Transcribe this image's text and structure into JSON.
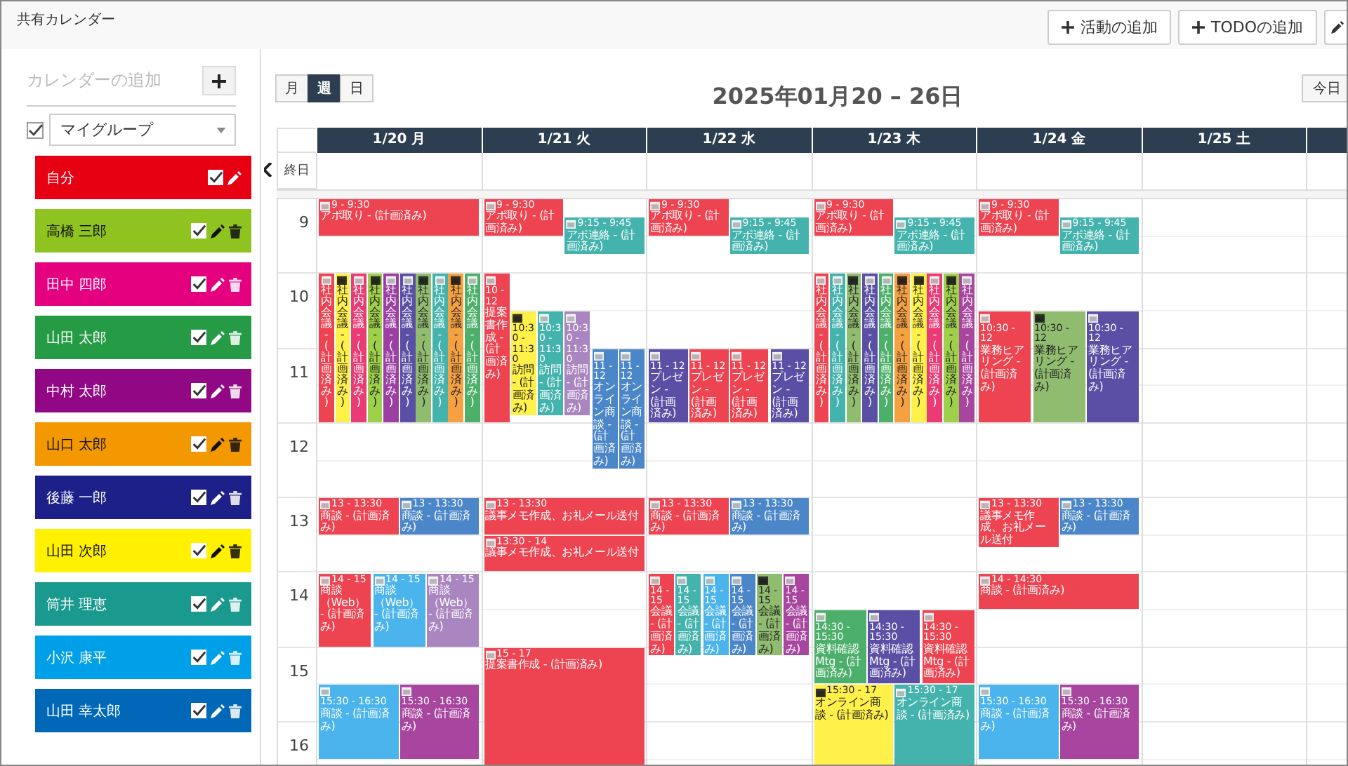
{
  "header": {
    "title": "共有カレンダー",
    "buttons": [
      "活動の追加",
      "TODOの追加"
    ]
  },
  "sidebar": {
    "add_label": "カレンダーの追加",
    "group": {
      "name": "マイグループ",
      "checked": true
    },
    "calendars": [
      {
        "name": "自分",
        "color": "#e60012",
        "checked": true,
        "deletable": false
      },
      {
        "name": "高橋 三郎",
        "color": "#8fc31f",
        "checked": true,
        "deletable": true
      },
      {
        "name": "田中 四郎",
        "color": "#e4007f",
        "checked": true,
        "deletable": true
      },
      {
        "name": "山田 太郎",
        "color": "#259b45",
        "checked": true,
        "deletable": true
      },
      {
        "name": "中村 太郎",
        "color": "#920783",
        "checked": true,
        "deletable": true
      },
      {
        "name": "山口 太郎",
        "color": "#f39800",
        "checked": true,
        "deletable": true
      },
      {
        "name": "後藤 一郎",
        "color": "#1d2088",
        "checked": true,
        "deletable": true
      },
      {
        "name": "山田 次郎",
        "color": "#fff100",
        "checked": true,
        "deletable": true
      },
      {
        "name": "筒井 理恵",
        "color": "#1a9a8e",
        "checked": true,
        "deletable": true
      },
      {
        "name": "小沢 康平",
        "color": "#00a0e9",
        "checked": true,
        "deletable": true
      },
      {
        "name": "山田 幸太郎",
        "color": "#0068b7",
        "checked": true,
        "deletable": true
      }
    ]
  },
  "views": [
    {
      "label": "月",
      "selected": false
    },
    {
      "label": "週",
      "selected": true
    },
    {
      "label": "日",
      "selected": false
    }
  ],
  "range_title": "2025年01月20 – 26日",
  "today_button": "今日",
  "all_day_label": "終日",
  "hours": [
    "9",
    "10",
    "11",
    "12",
    "13",
    "14",
    "15",
    "16"
  ],
  "days": [
    {
      "label": "1/20 月",
      "events": [
        {
          "time": "9 - 9:30",
          "title": "アポ取り - (計画済み)",
          "color": "#ee4451"
        },
        {
          "title": "社内会議 - (計画済み)",
          "color": "#ee4451"
        },
        {
          "title": "社内会議 - (計画済み)",
          "color": "#fff04a"
        },
        {
          "title": "社内会議 - (計画済み)",
          "color": "#ea3b74"
        },
        {
          "title": "社内会議 - (計画済み)",
          "color": "#9fd04a"
        },
        {
          "title": "社内会議 - (計画済み)",
          "color": "#9b3fa3"
        },
        {
          "title": "社内会議 - (計画済み)",
          "color": "#5b4ea5"
        },
        {
          "title": "社内会議 - (計画済み)",
          "color": "#8fbc6f"
        },
        {
          "title": "社内会議 - (計画済み)",
          "color": "#45b3ad"
        },
        {
          "title": "社内会議 - (計画済み)",
          "color": "#f5a142"
        },
        {
          "title": "社内会議 - (計画済み)",
          "color": "#4caf6a"
        },
        {
          "time": "13 - 13:30",
          "title": "商談 - (計画済み)",
          "color": "#ee4451"
        },
        {
          "time": "13 - 13:30",
          "title": "商談 - (計画済み)",
          "color": "#4a86c8"
        },
        {
          "time": "14 - 15",
          "title": "商談（Web） - (計画済み)",
          "color": "#ee4451"
        },
        {
          "time": "14 - 15",
          "title": "商談（Web） - (計画済み)",
          "color": "#4cb4ec"
        },
        {
          "time": "14 - 15",
          "title": "商談（Web） - (計画済み)",
          "color": "#aa86c0"
        },
        {
          "time": "15:30 - 16:30",
          "title": "商談 - (計画済み)",
          "color": "#4cb4ec"
        },
        {
          "time": "15:30 - 16:30",
          "title": "商談 - (計画済み)",
          "color": "#a8459e"
        }
      ]
    },
    {
      "label": "1/21 火",
      "events": [
        {
          "time": "9 - 9:30",
          "title": "アポ取り - (計画済み)",
          "color": "#ee4451"
        },
        {
          "time": "9:15 - 9:45",
          "title": "アポ連絡 - (計画済み)",
          "color": "#45b3ad"
        },
        {
          "time": "10 - 12",
          "title": "提案書作成 - (計画済み)",
          "color": "#ee4451"
        },
        {
          "time": "10:30 - 11:30",
          "title": "訪問 - (計画済み)",
          "color": "#fff04a"
        },
        {
          "time": "10:30 - 11:30",
          "title": "訪問 - (計画済み)",
          "color": "#45b3ad"
        },
        {
          "time": "10:30 - 11:30",
          "title": "訪問 - (計画済み)",
          "color": "#aa86c0"
        },
        {
          "time": "11 - 12",
          "title": "オンライン商談 - (計画済み)",
          "color": "#4a86c8"
        },
        {
          "time": "11 - 12",
          "title": "オンライン商談 - (計画済み)",
          "color": "#4a86c8"
        },
        {
          "time": "13 - 13:30",
          "title": "議事メモ作成、お礼メール送付",
          "color": "#ee4451"
        },
        {
          "time": "13:30 - 14",
          "title": "議事メモ作成、お礼メール送付",
          "color": "#ee4451"
        },
        {
          "time": "15 - 17",
          "title": "提案書作成 - (計画済み)",
          "color": "#ee4451"
        }
      ]
    },
    {
      "label": "1/22 水",
      "events": [
        {
          "time": "9 - 9:30",
          "title": "アポ取り - (計画済み)",
          "color": "#ee4451"
        },
        {
          "time": "9:15 - 9:45",
          "title": "アポ連絡 - (計画済み)",
          "color": "#45b3ad"
        },
        {
          "time": "11 - 12",
          "title": "プレゼン - (計画済み)",
          "color": "#5b4ea5"
        },
        {
          "time": "11 - 12",
          "title": "プレゼン - (計画済み)",
          "color": "#ee4451"
        },
        {
          "time": "11 - 12",
          "title": "プレゼン - (計画済み)",
          "color": "#ee4451"
        },
        {
          "time": "11 - 12",
          "title": "プレゼン - (計画済み)",
          "color": "#5b4ea5"
        },
        {
          "time": "13 - 13:30",
          "title": "商談 - (計画済み)",
          "color": "#ee4451"
        },
        {
          "time": "13 - 13:30",
          "title": "商談 - (計画済み)",
          "color": "#4a86c8"
        },
        {
          "time": "14 - 15",
          "title": "会議 - (計画済み)",
          "color": "#ee4451"
        },
        {
          "time": "14 - 15",
          "title": "会議 - (計画済み)",
          "color": "#45b3ad"
        },
        {
          "time": "14 - 15",
          "title": "会議 - (計画済み)",
          "color": "#4cb4ec"
        },
        {
          "time": "14 - 15",
          "title": "会議 - (計画済み)",
          "color": "#4a86c8"
        },
        {
          "time": "14 - 15",
          "title": "会議 - (計画済み)",
          "color": "#8fbc6f"
        },
        {
          "time": "14 - 15",
          "title": "会議 - (計画済み)",
          "color": "#a8459e"
        }
      ]
    },
    {
      "label": "1/23 木",
      "events": [
        {
          "time": "9 - 9:30",
          "title": "アポ取り - (計画済み)",
          "color": "#ee4451"
        },
        {
          "time": "9:15 - 9:45",
          "title": "アポ連絡 - (計画済み)",
          "color": "#45b3ad"
        },
        {
          "title": "社内会議 - (計画済み)",
          "color": "#ee4451"
        },
        {
          "title": "社内会議 - (計画済み)",
          "color": "#45b3ad"
        },
        {
          "title": "社内会議 - (計画済み)",
          "color": "#8fbc6f"
        },
        {
          "title": "社内会議 - (計画済み)",
          "color": "#5b4ea5"
        },
        {
          "title": "社内会議 - (計画済み)",
          "color": "#4caf6a"
        },
        {
          "title": "社内会議 - (計画済み)",
          "color": "#f5a142"
        },
        {
          "title": "社内会議 - (計画済み)",
          "color": "#fff04a"
        },
        {
          "title": "社内会議 - (計画済み)",
          "color": "#ea3b74"
        },
        {
          "title": "社内会議 - (計画済み)",
          "color": "#9fd04a"
        },
        {
          "title": "社内会議 - (計画済み)",
          "color": "#a8459e"
        },
        {
          "time": "14:30 - 15:30",
          "title": "資料確認Mtg - (計画済み)",
          "color": "#4caf6a"
        },
        {
          "time": "14:30 - 15:30",
          "title": "資料確認Mtg - (計画済み)",
          "color": "#5b4ea5"
        },
        {
          "time": "14:30 - 15:30",
          "title": "資料確認Mtg - (計画済み)",
          "color": "#ee4451"
        },
        {
          "time": "15:30 - 17",
          "title": "オンライン商談 - (計画済み)",
          "color": "#fff04a"
        },
        {
          "time": "15:30 - 17",
          "title": "オンライン商談 - (計画済み)",
          "color": "#45b3ad"
        }
      ]
    },
    {
      "label": "1/24 金",
      "events": [
        {
          "time": "9 - 9:30",
          "title": "アポ取り - (計画済み)",
          "color": "#ee4451"
        },
        {
          "time": "9:15 - 9:45",
          "title": "アポ連絡 - (計画済み)",
          "color": "#45b3ad"
        },
        {
          "time": "10:30 - 12",
          "title": "業務ヒアリング - (計画済み)",
          "color": "#ee4451"
        },
        {
          "time": "10:30 - 12",
          "title": "業務ヒアリング - (計画済み)",
          "color": "#8fbc6f"
        },
        {
          "time": "10:30 - 12",
          "title": "業務ヒアリング - (計画済み)",
          "color": "#5b4ea5"
        },
        {
          "time": "13 - 13:30",
          "title": "議事メモ作成、お礼メール送付",
          "color": "#ee4451"
        },
        {
          "time": "13 - 13:30",
          "title": "商談 - (計画済み)",
          "color": "#4a86c8"
        },
        {
          "time": "14 - 14:30",
          "title": "商談 - (計画済み)",
          "color": "#ee4451"
        },
        {
          "time": "15:30 - 16:30",
          "title": "商談 - (計画済み)",
          "color": "#4cb4ec"
        },
        {
          "time": "15:30 - 16:30",
          "title": "商談 - (計画済み)",
          "color": "#a8459e"
        }
      ]
    },
    {
      "label": "1/25 土"
    }
  ]
}
